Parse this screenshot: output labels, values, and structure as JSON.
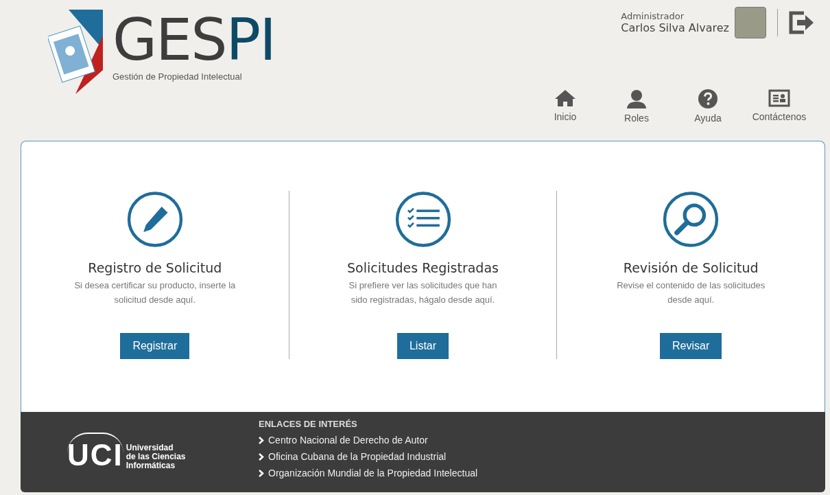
{
  "logo": {
    "word_parts": [
      "GES",
      "PI"
    ],
    "subtitle": "Gestión de Propiedad Intelectual"
  },
  "user": {
    "role": "Administrador",
    "name": "Carlos Silva Alvarez"
  },
  "nav": [
    {
      "kind": "home",
      "label": "Inicio"
    },
    {
      "kind": "person",
      "label": "Roles"
    },
    {
      "kind": "help",
      "label": "Ayuda"
    },
    {
      "kind": "card",
      "label": "Contáctenos"
    }
  ],
  "actions": [
    {
      "kind": "pencil",
      "title": "Registro de Solicitud",
      "text": "Si desea certificar su producto, inserte la solicitud desde aquí.",
      "button": "Registrar"
    },
    {
      "kind": "list",
      "title": "Solicitudes Registradas",
      "text": "Si prefiere ver las solicitudes que han sido registradas, hágalo desde aquí.",
      "button": "Listar"
    },
    {
      "kind": "search",
      "title": "Revisión de Solicitud",
      "text": "Revise el contenido de las solicitudes desde aquí.",
      "button": "Revisar"
    }
  ],
  "footer": {
    "uci_mark": "UCI",
    "uci_name": [
      "Universidad",
      "de las Ciencias",
      "Informáticas"
    ],
    "links_title": "ENLACES DE INTERÉS",
    "links": [
      "Centro Nacional de Derecho de Autor",
      "Oficina Cubana de la Propiedad Industrial",
      "Organización Mundial de la Propiedad Intelectual"
    ]
  }
}
